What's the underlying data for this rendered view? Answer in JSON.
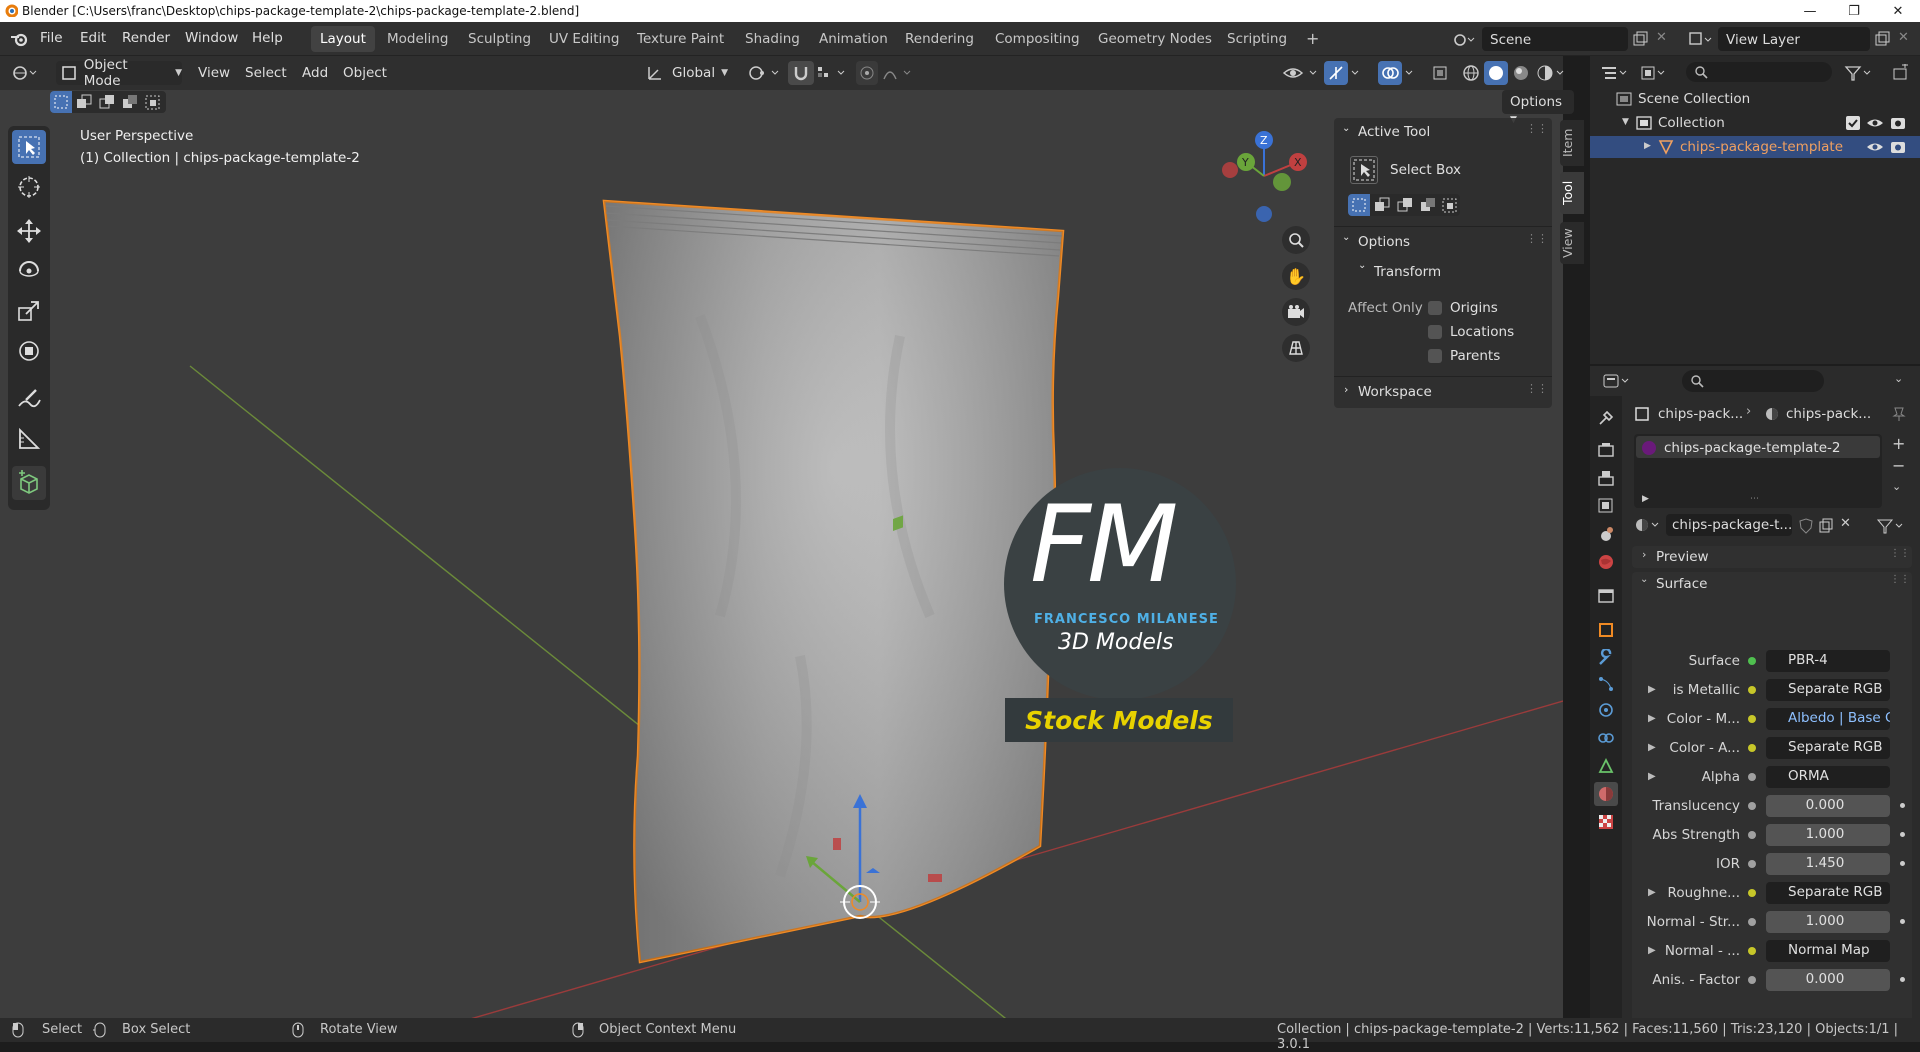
{
  "window": {
    "title": "Blender [C:\\Users\\franc\\Desktop\\chips-package-template-2\\chips-package-template-2.blend]"
  },
  "menu": [
    "File",
    "Edit",
    "Render",
    "Window",
    "Help"
  ],
  "workspaces": [
    "Layout",
    "Modeling",
    "Sculpting",
    "UV Editing",
    "Texture Paint",
    "Shading",
    "Animation",
    "Rendering",
    "Compositing",
    "Geometry Nodes",
    "Scripting"
  ],
  "scene": {
    "name": "Scene",
    "view_layer": "View Layer"
  },
  "viewport_header": {
    "mode": "Object Mode",
    "menus": [
      "View",
      "Select",
      "Add",
      "Object"
    ],
    "orientation": "Global",
    "options": "Options"
  },
  "viewport": {
    "perspective": "User Perspective",
    "collection_info": "(1) Collection | chips-package-template-2"
  },
  "watermark": {
    "logo": "FM",
    "brand": "FRANCESCO MILANESE",
    "subtitle": "3D Models",
    "banner": "Stock Models"
  },
  "npanel": {
    "tabs": [
      "Item",
      "Tool",
      "View"
    ],
    "active_tool_header": "Active Tool",
    "tool_name": "Select Box",
    "options_header": "Options",
    "transform_header": "Transform",
    "affect_only": "Affect Only",
    "checks": [
      "Origins",
      "Locations",
      "Parents"
    ],
    "workspace_header": "Workspace"
  },
  "gizmo": {
    "z": "Z",
    "y": "Y",
    "x": "X"
  },
  "outliner": {
    "scene_collection": "Scene Collection",
    "collection": "Collection",
    "object": "chips-package-template"
  },
  "properties": {
    "breadcrumb": [
      "chips-pack...",
      "chips-pack..."
    ],
    "slot": "chips-package-template-2",
    "material": "chips-package-t...",
    "preview": "Preview",
    "surface_header": "Surface",
    "rows": [
      {
        "label": "Surface",
        "value": "PBR-4",
        "dot": "#4fc04f",
        "type": "link",
        "tri": false
      },
      {
        "label": "is Metallic",
        "value": "Separate RGB",
        "dot": "#c7c729",
        "type": "link",
        "tri": true
      },
      {
        "label": "Color - M...",
        "value": "Albedo | Base C...",
        "dot": "#c7c729",
        "type": "link",
        "tri": true,
        "hl": true
      },
      {
        "label": "Color - A...",
        "value": "Separate RGB",
        "dot": "#c7c729",
        "type": "link",
        "tri": true
      },
      {
        "label": "Alpha",
        "value": "ORMA",
        "dot": "#a0a0a0",
        "type": "link",
        "tri": true
      },
      {
        "label": "Translucency",
        "value": "0.000",
        "dot": "#a0a0a0",
        "type": "num",
        "tri": false
      },
      {
        "label": "Abs Strength",
        "value": "1.000",
        "dot": "#a0a0a0",
        "type": "num",
        "tri": false
      },
      {
        "label": "IOR",
        "value": "1.450",
        "dot": "#a0a0a0",
        "type": "num",
        "tri": false
      },
      {
        "label": "Roughne...",
        "value": "Separate RGB",
        "dot": "#c7c729",
        "type": "link",
        "tri": true
      },
      {
        "label": "Normal - Str...",
        "value": "1.000",
        "dot": "#a0a0a0",
        "type": "num",
        "tri": false
      },
      {
        "label": "Normal - ...",
        "value": "Normal Map",
        "dot": "#c7c729",
        "type": "link",
        "tri": true
      },
      {
        "label": "Anis. - Factor",
        "value": "0.000",
        "dot": "#a0a0a0",
        "type": "num",
        "tri": false
      }
    ]
  },
  "statusbar": {
    "select": "Select",
    "box_select": "Box Select",
    "rotate": "Rotate View",
    "context": "Object Context Menu",
    "stats": "Collection | chips-package-template-2 | Verts:11,562 | Faces:11,560 | Tris:23,120 | Objects:1/1 | 3.0.1"
  },
  "colors": {
    "accent": "#4772b3",
    "selection": "#f08a24",
    "banner_text": "#e8d200"
  }
}
